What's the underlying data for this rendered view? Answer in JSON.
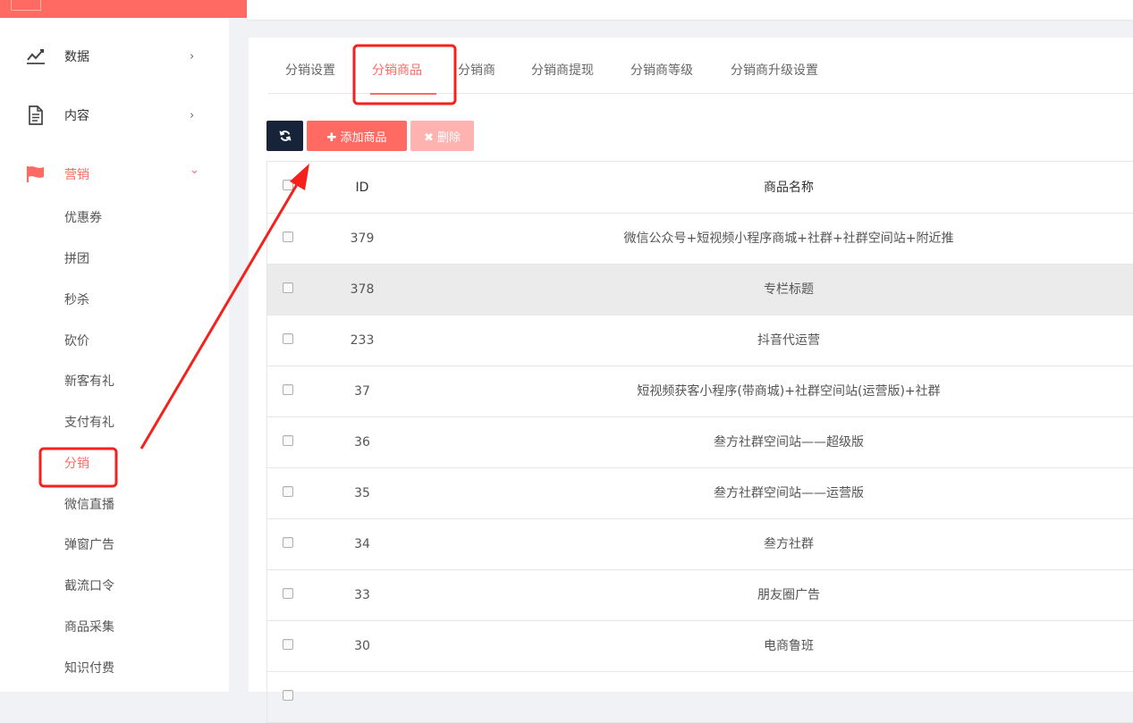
{
  "sidebar": {
    "menu": [
      {
        "label": "数据",
        "icon": "chart-line-icon",
        "chevron": "›"
      },
      {
        "label": "内容",
        "icon": "document-icon",
        "chevron": "›"
      },
      {
        "label": "营销",
        "icon": "flag-icon",
        "chevron": "⌄"
      }
    ],
    "submenu": [
      "优惠券",
      "拼团",
      "秒杀",
      "砍价",
      "新客有礼",
      "支付有礼",
      "分销",
      "微信直播",
      "弹窗广告",
      "截流口令",
      "商品采集",
      "知识付费"
    ]
  },
  "tabs": [
    "分销设置",
    "分销商品",
    "分销商",
    "分销商提现",
    "分销商等级",
    "分销商升级设置"
  ],
  "toolbar": {
    "refresh_icon": "refresh-icon",
    "add_label": "✚ 添加商品",
    "delete_label": "✖ 删除"
  },
  "table": {
    "headers": {
      "id": "ID",
      "name": "商品名称"
    },
    "rows": [
      {
        "id": "379",
        "name": "微信公众号+短视频小程序商城+社群+社群空间站+附近推"
      },
      {
        "id": "378",
        "name": "专栏标题"
      },
      {
        "id": "233",
        "name": "抖音代运营"
      },
      {
        "id": "37",
        "name": "短视频获客小程序(带商城)+社群空间站(运营版)+社群"
      },
      {
        "id": "36",
        "name": "叁方社群空间站——超级版"
      },
      {
        "id": "35",
        "name": "叁方社群空间站——运营版"
      },
      {
        "id": "34",
        "name": "叁方社群"
      },
      {
        "id": "33",
        "name": "朋友圈广告"
      },
      {
        "id": "30",
        "name": "电商鲁班"
      }
    ]
  },
  "colors": {
    "accent": "#ff6a63",
    "dark_button": "#172338",
    "annotation": "#f5211c"
  }
}
